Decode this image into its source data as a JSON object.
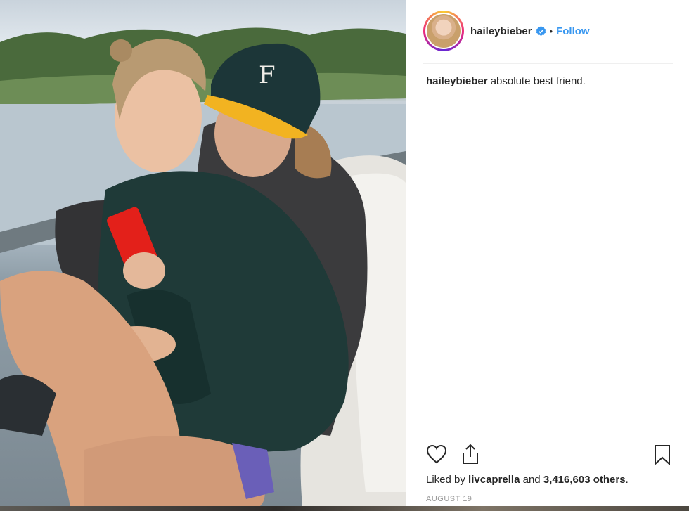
{
  "post": {
    "username": "haileybieber",
    "follow_label": "Follow",
    "separator": "•",
    "caption_user": "haileybieber",
    "caption_text": "absolute best friend.",
    "liked_by_prefix": "Liked by",
    "liked_by_user": "livcaprella",
    "liked_by_and": "and",
    "liked_by_count": "3,416,603 others",
    "liked_by_suffix": ".",
    "date": "AUGUST 19"
  },
  "icons": {
    "verified": "verified-badge-icon",
    "like": "heart-icon",
    "share": "share-icon",
    "save": "bookmark-icon"
  },
  "colors": {
    "accent": "#3897f0",
    "text": "#262626",
    "muted": "#999999",
    "phone": "#e3201a",
    "cap_brim": "#f2b321",
    "hoodie": "#1f3a38"
  }
}
